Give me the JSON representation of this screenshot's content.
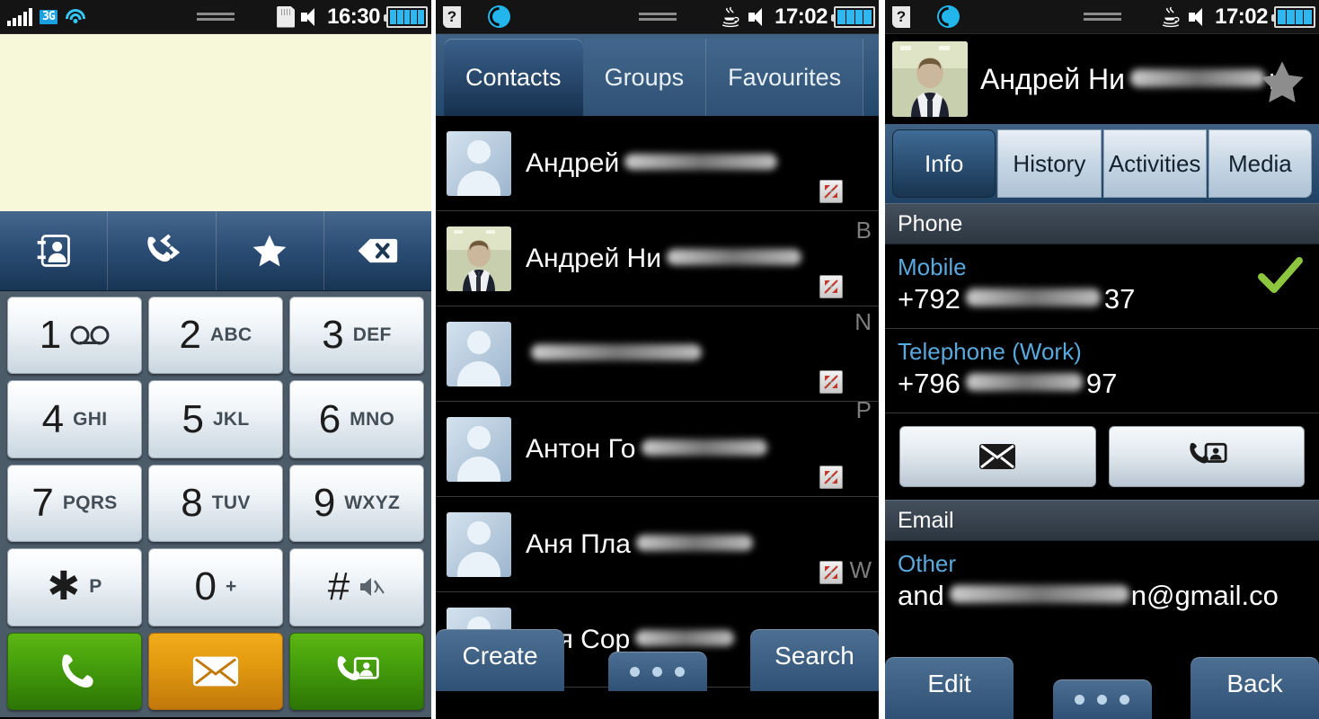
{
  "panel_dialer": {
    "status": {
      "signal_icon": "signal-bars-icon",
      "network_label": "3G",
      "wifi_icon": "wifi-icon",
      "dashes_icon": "menu-dashes-icon",
      "sdcard_icon": "sd-card-icon",
      "speaker_icon": "speaker-icon",
      "time": "16:30",
      "battery_icon": "battery-icon",
      "battery_bars": 5
    },
    "toolbar": [
      {
        "name": "contacts-book-icon",
        "label": "Contacts"
      },
      {
        "name": "call-log-icon",
        "label": "Logs"
      },
      {
        "name": "favourites-star-icon",
        "label": "Favourites"
      },
      {
        "name": "backspace-icon",
        "label": "Backspace"
      }
    ],
    "keys": [
      {
        "num": "1",
        "sub": "",
        "glyph": "voicemail-icon"
      },
      {
        "num": "2",
        "sub": "ABC",
        "glyph": ""
      },
      {
        "num": "3",
        "sub": "DEF",
        "glyph": ""
      },
      {
        "num": "4",
        "sub": "GHI",
        "glyph": ""
      },
      {
        "num": "5",
        "sub": "JKL",
        "glyph": ""
      },
      {
        "num": "6",
        "sub": "MNO",
        "glyph": ""
      },
      {
        "num": "7",
        "sub": "PQRS",
        "glyph": ""
      },
      {
        "num": "8",
        "sub": "TUV",
        "glyph": ""
      },
      {
        "num": "9",
        "sub": "WXYZ",
        "glyph": ""
      },
      {
        "num": "✱",
        "sub": "P",
        "glyph": ""
      },
      {
        "num": "0",
        "sub": "+",
        "glyph": ""
      },
      {
        "num": "#",
        "sub": "",
        "glyph": "mute-icon"
      }
    ],
    "action_keys": [
      {
        "name": "call-button",
        "icon": "handset-icon",
        "color": "#46a00c"
      },
      {
        "name": "message-button",
        "icon": "envelope-icon",
        "color": "#e39b10"
      },
      {
        "name": "add-contact-button",
        "icon": "call-contact-icon",
        "color": "#46a00c"
      }
    ]
  },
  "panel_contacts": {
    "status": {
      "help_icon": "question-document-icon",
      "sync_icon": "sync-icon",
      "dashes_icon": "menu-dashes-icon",
      "java_icon": "java-cup-icon",
      "speaker_icon": "speaker-icon",
      "time": "17:02",
      "battery_icon": "battery-icon",
      "battery_bars": 4
    },
    "tabs": [
      {
        "label": "Contacts",
        "active": true
      },
      {
        "label": "Groups",
        "active": false
      },
      {
        "label": "Favourites",
        "active": false
      }
    ],
    "rows": [
      {
        "name": "Андрей",
        "blur_width": 170,
        "avatar": "placeholder",
        "link_icon": "linked-contact-icon",
        "index": ""
      },
      {
        "name": "Андрей Ни",
        "blur_width": 150,
        "avatar": "photo",
        "link_icon": "linked-contact-icon",
        "index": "B"
      },
      {
        "name": "",
        "blur_width": 190,
        "avatar": "placeholder",
        "link_icon": "linked-contact-icon",
        "index": "N"
      },
      {
        "name": "Антон Го",
        "blur_width": 140,
        "avatar": "placeholder",
        "link_icon": "linked-contact-icon",
        "index": "P"
      },
      {
        "name": "Аня Пла",
        "blur_width": 130,
        "avatar": "placeholder",
        "link_icon": "linked-contact-icon",
        "index": "W"
      },
      {
        "name": "Аня Сор",
        "blur_width": 110,
        "avatar": "placeholder",
        "link_icon": "linked-contact-icon",
        "index": "#"
      }
    ],
    "softkeys": {
      "left": "Create",
      "right": "Search",
      "middle_icon": "more-options-dots-icon"
    }
  },
  "panel_detail": {
    "status": {
      "help_icon": "question-document-icon",
      "sync_icon": "sync-icon",
      "dashes_icon": "menu-dashes-icon",
      "java_icon": "java-cup-icon",
      "speaker_icon": "speaker-icon",
      "time": "17:02",
      "battery_icon": "battery-icon",
      "battery_bars": 4
    },
    "header": {
      "name_prefix": "Андрей Ни",
      "name_suffix": "н",
      "blur_width": 150,
      "avatar": "photo",
      "favourite_icon": "favourite-star-icon"
    },
    "tabs": [
      {
        "label": "Info",
        "active": true
      },
      {
        "label": "History",
        "active": false
      },
      {
        "label": "Activities",
        "active": false
      },
      {
        "label": "Media",
        "active": false
      }
    ],
    "sections": [
      {
        "title": "Phone",
        "fields": [
          {
            "label": "Mobile",
            "value_prefix": "+792",
            "value_suffix": "37",
            "blur_width": 150,
            "default_icon": "default-check-icon"
          },
          {
            "label": "Telephone (Work)",
            "value_prefix": "+796",
            "value_suffix": "97",
            "blur_width": 130,
            "default_icon": ""
          }
        ]
      }
    ],
    "actions": [
      {
        "name": "send-message-button",
        "icon": "envelope-icon"
      },
      {
        "name": "call-contact-button",
        "icon": "call-contact-icon"
      }
    ],
    "email_section": {
      "title": "Email",
      "label": "Other",
      "value_prefix": "and",
      "value_suffix": "n@gmail.co",
      "blur_width": 200
    },
    "softkeys": {
      "left": "Edit",
      "right": "Back",
      "middle_icon": "more-options-dots-icon"
    }
  },
  "colors": {
    "accent_blue": "#2e5175",
    "status_black": "#141414",
    "dial_display": "#f7f7da",
    "green_call": "#46a00c",
    "orange_msg": "#e39b10",
    "link_red": "#c0392b",
    "label_blue": "#59a9dd",
    "check_green": "#8cc63f",
    "sync_cyan": "#22b6ec",
    "net_badge": "#1a9fe0"
  }
}
